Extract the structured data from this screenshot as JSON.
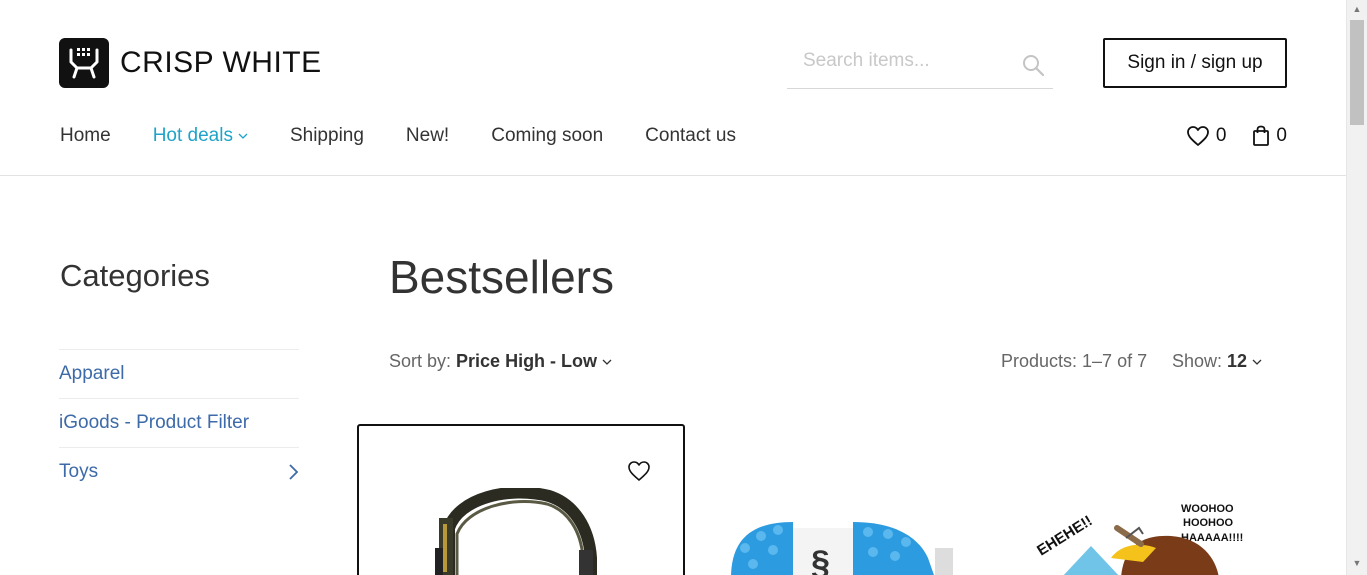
{
  "brand": {
    "name": "CRISP WHITE"
  },
  "search": {
    "placeholder": "Search items..."
  },
  "account": {
    "signin_label": "Sign in / sign up"
  },
  "nav": {
    "items": [
      {
        "label": "Home",
        "active": false
      },
      {
        "label": "Hot deals",
        "active": true,
        "has_dropdown": true
      },
      {
        "label": "Shipping",
        "active": false
      },
      {
        "label": "New!",
        "active": false
      },
      {
        "label": "Coming soon",
        "active": false
      },
      {
        "label": "Contact us",
        "active": false
      }
    ]
  },
  "counters": {
    "wishlist_count": "0",
    "cart_count": "0"
  },
  "sidebar": {
    "title": "Categories",
    "items": [
      {
        "label": "Apparel",
        "has_children": false
      },
      {
        "label": "iGoods - Product Filter",
        "has_children": false
      },
      {
        "label": "Toys",
        "has_children": true
      }
    ]
  },
  "main": {
    "title": "Bestsellers",
    "sort_label": "Sort by:",
    "sort_value": "Price High - Low",
    "products_count": "Products: 1–7 of 7",
    "show_label": "Show:",
    "show_value": "12"
  },
  "products": [
    {
      "image": "headphones",
      "hovered": true
    },
    {
      "image": "robot-ball-toy"
    },
    {
      "image": "cartoon-toy",
      "image_text_left": "EHEHE!!",
      "image_text_right": "WOOHOO HOOHOO HAAAAA!!!!"
    }
  ],
  "colors": {
    "accent": "#1fa3c9",
    "link": "#3d6aa8",
    "text": "#333333"
  }
}
